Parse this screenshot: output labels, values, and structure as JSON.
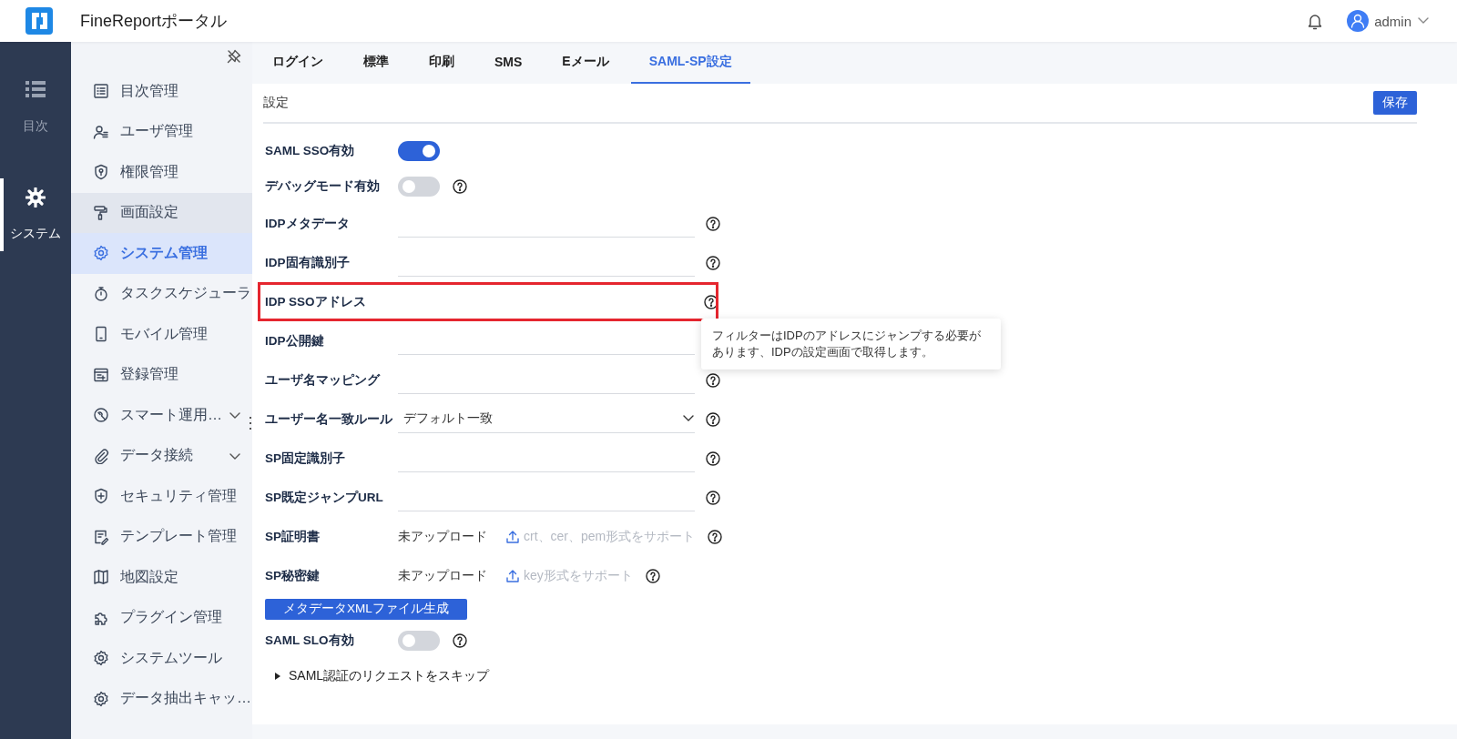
{
  "header": {
    "title": "FineReportポータル",
    "user": "admin"
  },
  "rail": [
    {
      "label": "目次",
      "selected": false
    },
    {
      "label": "システム",
      "selected": true
    }
  ],
  "sidebar": {
    "items": [
      {
        "label": "目次管理",
        "selected": false,
        "hovered": false,
        "submenu": false
      },
      {
        "label": "ユーザ管理",
        "selected": false,
        "hovered": false,
        "submenu": false
      },
      {
        "label": "権限管理",
        "selected": false,
        "hovered": false,
        "submenu": false
      },
      {
        "label": "画面設定",
        "selected": false,
        "hovered": true,
        "submenu": false
      },
      {
        "label": "システム管理",
        "selected": true,
        "hovered": false,
        "submenu": false
      },
      {
        "label": "タスクスケジューラ",
        "selected": false,
        "hovered": false,
        "submenu": false
      },
      {
        "label": "モバイル管理",
        "selected": false,
        "hovered": false,
        "submenu": false
      },
      {
        "label": "登録管理",
        "selected": false,
        "hovered": false,
        "submenu": false
      },
      {
        "label": "スマート運用…",
        "selected": false,
        "hovered": false,
        "submenu": true
      },
      {
        "label": "データ接続",
        "selected": false,
        "hovered": false,
        "submenu": true
      },
      {
        "label": "セキュリティ管理",
        "selected": false,
        "hovered": false,
        "submenu": false
      },
      {
        "label": "テンプレート管理",
        "selected": false,
        "hovered": false,
        "submenu": false
      },
      {
        "label": "地図設定",
        "selected": false,
        "hovered": false,
        "submenu": false
      },
      {
        "label": "プラグイン管理",
        "selected": false,
        "hovered": false,
        "submenu": false
      },
      {
        "label": "システムツール",
        "selected": false,
        "hovered": false,
        "submenu": false
      },
      {
        "label": "データ抽出キャッ…",
        "selected": false,
        "hovered": false,
        "submenu": false
      }
    ]
  },
  "tabs": [
    {
      "label": "ログイン",
      "selected": false
    },
    {
      "label": "標準",
      "selected": false
    },
    {
      "label": "印刷",
      "selected": false
    },
    {
      "label": "SMS",
      "selected": false
    },
    {
      "label": "Eメール",
      "selected": false
    },
    {
      "label": "SAML-SP設定",
      "selected": true
    }
  ],
  "section": {
    "title": "設定",
    "save_button": "保存"
  },
  "rows": [
    {
      "kind": "toggle",
      "label": "SAML SSO有効",
      "on": true,
      "help": false
    },
    {
      "kind": "toggle",
      "label": "デバッグモード有効",
      "on": false,
      "help": true
    },
    {
      "kind": "text",
      "label": "IDPメタデータ",
      "help": true,
      "highlighted": false
    },
    {
      "kind": "text",
      "label": "IDP固有識別子",
      "help": true,
      "highlighted": false
    },
    {
      "kind": "text",
      "label": "IDP SSOアドレス",
      "help": true,
      "highlighted": true
    },
    {
      "kind": "text",
      "label": "IDP公開鍵",
      "help": false,
      "highlighted": false
    },
    {
      "kind": "text",
      "label": "ユーザ名マッピング",
      "help": true,
      "highlighted": false
    },
    {
      "kind": "select",
      "label": "ユーザー名一致ルール",
      "value": "デフォルト一致",
      "help": true
    },
    {
      "kind": "text",
      "label": "SP固定識別子",
      "help": true,
      "highlighted": false
    },
    {
      "kind": "text",
      "label": "SP既定ジャンプURL",
      "help": true,
      "highlighted": false
    },
    {
      "kind": "upload",
      "label": "SP証明書",
      "status": "未アップロード",
      "hint": "crt、cer、pem形式をサポート",
      "help": true
    },
    {
      "kind": "upload",
      "label": "SP秘密鍵",
      "status": "未アップロード",
      "hint": "key形式をサポート",
      "help": true
    },
    {
      "kind": "button",
      "label": "メタデータXMLファイル生成"
    },
    {
      "kind": "toggle",
      "label": "SAML SLO有効",
      "on": false,
      "help": true
    },
    {
      "kind": "collapse",
      "label": "SAML認証のリクエストをスキップ",
      "expanded": false
    }
  ],
  "tooltip": {
    "text": "フィルターはIDPのアドレスにジャンプする必要があります、IDPの設定画面で取得します。"
  }
}
